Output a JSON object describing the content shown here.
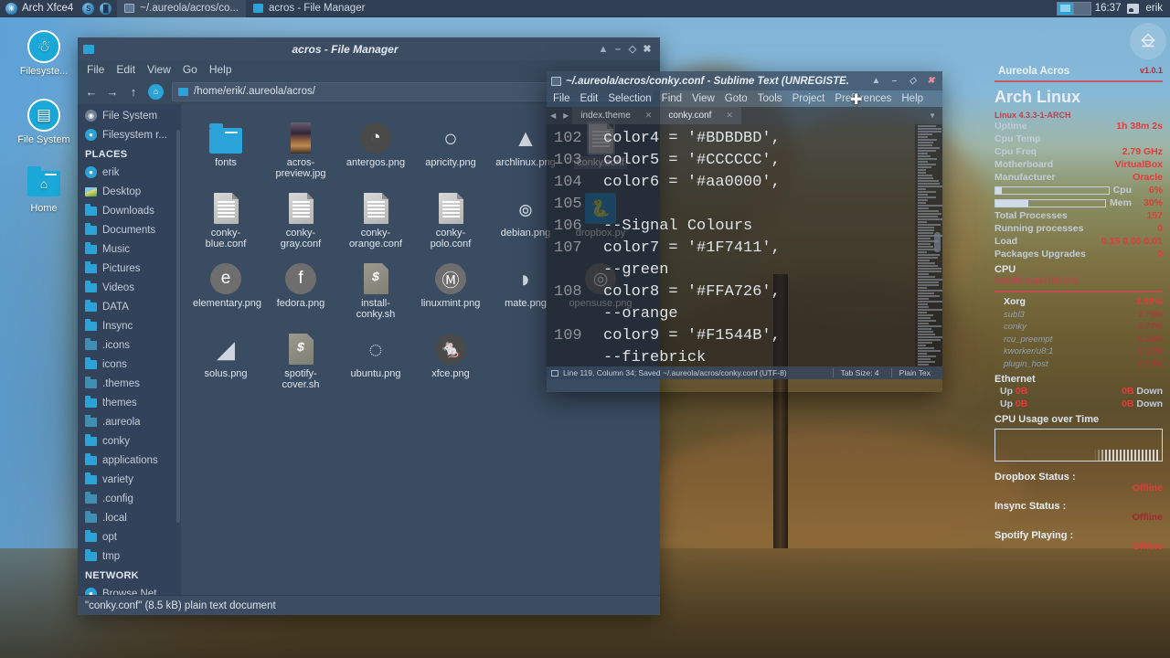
{
  "taskbar": {
    "app_menu_label": "Arch Xfce4",
    "launchers": [
      {
        "name": "globe-icon",
        "glyph": "◕"
      },
      {
        "name": "settings-icon",
        "glyph": "S"
      },
      {
        "name": "archive-icon",
        "glyph": "■"
      }
    ],
    "tasks": [
      {
        "label": "~/.aureola/acros/co...",
        "icon": "sublime-icon",
        "active": true
      },
      {
        "label": "acros - File Manager",
        "icon": "file-manager-icon",
        "active": false
      }
    ],
    "clock": "16:37",
    "user": "erik",
    "tray_icon": "image-viewer-icon"
  },
  "desktop_icons": [
    {
      "label": "Filesyste...",
      "icon": "usb-drive-icon",
      "glyph": "⑂"
    },
    {
      "label": "File System",
      "icon": "hard-drive-icon",
      "glyph": "▣"
    },
    {
      "label": "Home",
      "icon": "home-folder-icon",
      "glyph": "⌂"
    }
  ],
  "file_manager": {
    "title": "acros - File Manager",
    "menu": [
      "File",
      "Edit",
      "View",
      "Go",
      "Help"
    ],
    "nav": {
      "back": "←",
      "forward": "→",
      "up": "↑",
      "home": "⌂"
    },
    "path": "/home/erik/.aureola/acros/",
    "sidebar": {
      "top_partial": [
        {
          "label": "File System",
          "icon": "devices-icon",
          "type": "circle-grey"
        },
        {
          "label": "Filesystem r...",
          "icon": "filesystem-root-icon",
          "type": "circle"
        }
      ],
      "places_header": "PLACES",
      "places": [
        {
          "label": "erik",
          "icon": "home-icon",
          "type": "circle"
        },
        {
          "label": "Desktop",
          "icon": "desktop-icon",
          "type": "picture"
        },
        {
          "label": "Downloads",
          "icon": "folder-icon",
          "type": "folder"
        },
        {
          "label": "Documents",
          "icon": "folder-icon",
          "type": "folder"
        },
        {
          "label": "Music",
          "icon": "folder-icon",
          "type": "folder"
        },
        {
          "label": "Pictures",
          "icon": "folder-icon",
          "type": "folder"
        },
        {
          "label": "Videos",
          "icon": "folder-icon",
          "type": "folder"
        },
        {
          "label": "DATA",
          "icon": "folder-icon",
          "type": "folder"
        },
        {
          "label": "Insync",
          "icon": "folder-icon",
          "type": "folder"
        },
        {
          "label": ".icons",
          "icon": "folder-icon",
          "type": "folder-dim"
        },
        {
          "label": "icons",
          "icon": "folder-icon",
          "type": "folder"
        },
        {
          "label": ".themes",
          "icon": "folder-icon",
          "type": "folder-dim"
        },
        {
          "label": "themes",
          "icon": "folder-icon",
          "type": "folder"
        },
        {
          "label": ".aureola",
          "icon": "folder-icon",
          "type": "folder-dim"
        },
        {
          "label": "conky",
          "icon": "folder-icon",
          "type": "folder"
        },
        {
          "label": "applications",
          "icon": "folder-icon",
          "type": "folder"
        },
        {
          "label": "variety",
          "icon": "folder-icon",
          "type": "folder"
        },
        {
          "label": ".config",
          "icon": "folder-icon",
          "type": "folder-dim"
        },
        {
          "label": ".local",
          "icon": "folder-icon",
          "type": "folder-dim"
        },
        {
          "label": "opt",
          "icon": "folder-icon",
          "type": "folder"
        },
        {
          "label": "tmp",
          "icon": "folder-icon",
          "type": "folder"
        }
      ],
      "network_header": "NETWORK",
      "network": [
        {
          "label": "Browse Net...",
          "icon": "network-icon",
          "type": "circle"
        }
      ]
    },
    "files": [
      {
        "label": "fonts",
        "icon": "folder-icon",
        "type": "folder",
        "selected": false
      },
      {
        "label": "acros-preview.jpg",
        "icon": "image-thumb-icon",
        "type": "thumb",
        "selected": false
      },
      {
        "label": "antergos.png",
        "icon": "antergos-logo-icon",
        "type": "glyph-dark",
        "glyph": "◔",
        "selected": false
      },
      {
        "label": "apricity.png",
        "icon": "apricity-logo-icon",
        "type": "glyph-none",
        "glyph": "○",
        "selected": false
      },
      {
        "label": "archlinux.png",
        "icon": "archlinux-logo-icon",
        "type": "glyph-none",
        "glyph": "▲",
        "selected": false
      },
      {
        "label": "conky.conf",
        "icon": "text-file-icon",
        "type": "doc",
        "selected": true
      },
      {
        "label": "conky-blue.conf",
        "icon": "text-file-icon",
        "type": "doc",
        "selected": false
      },
      {
        "label": "conky-gray.conf",
        "icon": "text-file-icon",
        "type": "doc",
        "selected": false
      },
      {
        "label": "conky-orange.conf",
        "icon": "text-file-icon",
        "type": "doc",
        "selected": false
      },
      {
        "label": "conky-polo.conf",
        "icon": "text-file-icon",
        "type": "doc",
        "selected": false
      },
      {
        "label": "debian.png",
        "icon": "debian-logo-icon",
        "type": "glyph-none",
        "glyph": "๏",
        "selected": false
      },
      {
        "label": "dropbox.py",
        "icon": "python-file-icon",
        "type": "glyph-blue",
        "glyph": "🐍",
        "selected": false
      },
      {
        "label": "elementary.png",
        "icon": "elementary-logo-icon",
        "type": "glyph-grey",
        "glyph": "e",
        "selected": false
      },
      {
        "label": "fedora.png",
        "icon": "fedora-logo-icon",
        "type": "glyph-grey",
        "glyph": "f",
        "selected": false
      },
      {
        "label": "install-conky.sh",
        "icon": "shell-script-icon",
        "type": "sh",
        "selected": false
      },
      {
        "label": "linuxmint.png",
        "icon": "linuxmint-logo-icon",
        "type": "glyph-grey",
        "glyph": "Ⓜ",
        "selected": false
      },
      {
        "label": "mate.png",
        "icon": "mate-logo-icon",
        "type": "glyph-none",
        "glyph": "◗",
        "selected": false
      },
      {
        "label": "opensuse.png",
        "icon": "opensuse-logo-icon",
        "type": "glyph-grey",
        "glyph": "◎",
        "selected": false
      },
      {
        "label": "solus.png",
        "icon": "solus-logo-icon",
        "type": "glyph-none",
        "glyph": "◢",
        "selected": false
      },
      {
        "label": "spotify-cover.sh",
        "icon": "shell-script-icon",
        "type": "sh",
        "selected": false
      },
      {
        "label": "ubuntu.png",
        "icon": "ubuntu-logo-icon",
        "type": "glyph-none",
        "glyph": "◌",
        "selected": false
      },
      {
        "label": "xfce.png",
        "icon": "xfce-logo-icon",
        "type": "glyph-dark",
        "glyph": "🐁",
        "selected": false
      }
    ],
    "status": "\"conky.conf\" (8.5 kB) plain text document"
  },
  "sublime": {
    "title": "~/.aureola/acros/conky.conf - Sublime Text (UNREGISTE.",
    "menu": [
      "File",
      "Edit",
      "Selection",
      "Find",
      "View",
      "Goto",
      "Tools",
      "Project",
      "Preferences",
      "Help"
    ],
    "tabs": [
      {
        "label": "index.theme",
        "active": false
      },
      {
        "label": "conky.conf",
        "active": true
      }
    ],
    "code_lines": [
      {
        "num": "102",
        "text": "color4 = '#BDBDBD',"
      },
      {
        "num": "103",
        "text": "color5 = '#CCCCCC',"
      },
      {
        "num": "104",
        "text": "color6 = '#aa0000',"
      },
      {
        "num": "105",
        "text": ""
      },
      {
        "num": "106",
        "text": "--Signal Colours"
      },
      {
        "num": "107",
        "text": "color7 = '#1F7411',"
      },
      {
        "num": "",
        "text": "--green"
      },
      {
        "num": "108",
        "text": "color8 = '#FFA726',"
      },
      {
        "num": "",
        "text": "--orange"
      },
      {
        "num": "109",
        "text": "color9 = '#F1544B',"
      },
      {
        "num": "",
        "text": "--firebrick"
      }
    ],
    "status": {
      "position": "Line 119, Column 34; Saved ~/.aureola/acros/conky.conf (UTF-8)",
      "tab_size": "Tab Size: 4",
      "syntax": "Plain Tex"
    }
  },
  "conky": {
    "logo": "linuxmint-logo-icon",
    "header": {
      "title": "Aureola Acros",
      "version": "v1.0.1"
    },
    "distro": "Arch Linux",
    "kernel": "Linux 4.3.3-1-ARCH",
    "system": [
      {
        "label": "Uptime",
        "value": "1h 38m 2s"
      },
      {
        "label": "Cpu Temp",
        "value": ""
      },
      {
        "label": "Cpu Freq",
        "value": "2.79 GHz"
      },
      {
        "label": "Motherboard",
        "value": "VirtualBox"
      },
      {
        "label": "Manufacturer",
        "value": "Oracle"
      }
    ],
    "bars": [
      {
        "label": "Cpu",
        "value": "6%",
        "pct": 6
      },
      {
        "label": "Mem",
        "value": "30%",
        "pct": 30
      }
    ],
    "stats": [
      {
        "label": "Total Processes",
        "value": "157"
      },
      {
        "label": "Running processes",
        "value": "0"
      },
      {
        "label": "Load",
        "value": "0.15 0.06 0.01"
      },
      {
        "label": "Packages Upgrades",
        "value": "0"
      }
    ],
    "cpu_header": "CPU",
    "cpu_model": "Intel(R) Core(TM) i7 C",
    "processes": [
      {
        "name": "Xorg",
        "value": "3.59%",
        "top": true
      },
      {
        "name": "subl3",
        "value": "1.79%",
        "top": false
      },
      {
        "name": "conky",
        "value": "0.77%",
        "top": false
      },
      {
        "name": "rcu_preempt",
        "value": "0.26%",
        "top": false
      },
      {
        "name": "kworker/u8:1",
        "value": "0.26%",
        "top": false
      },
      {
        "name": "plugin_host",
        "value": "0.00%",
        "top": false
      }
    ],
    "ethernet_header": "Ethernet",
    "ethernet": [
      {
        "up_label": "Up",
        "up_value": "0B",
        "down_value": "0B",
        "down_label": "Down"
      },
      {
        "up_label": "Up",
        "up_value": "0B",
        "down_value": "0B",
        "down_label": "Down"
      }
    ],
    "graph_header": "CPU Usage over Time",
    "statuses": [
      {
        "label": "Dropbox Status :",
        "value": "Offline"
      },
      {
        "label": "Insync Status :",
        "value": "Offline"
      },
      {
        "label": "Spotify Playing :",
        "value": "Offline"
      }
    ]
  },
  "colors": {
    "accent_blue": "#2aa3d8",
    "conky_red": "#e03c3c",
    "panel_bg": "#2f3e52",
    "window_bg": "#384a5e"
  }
}
